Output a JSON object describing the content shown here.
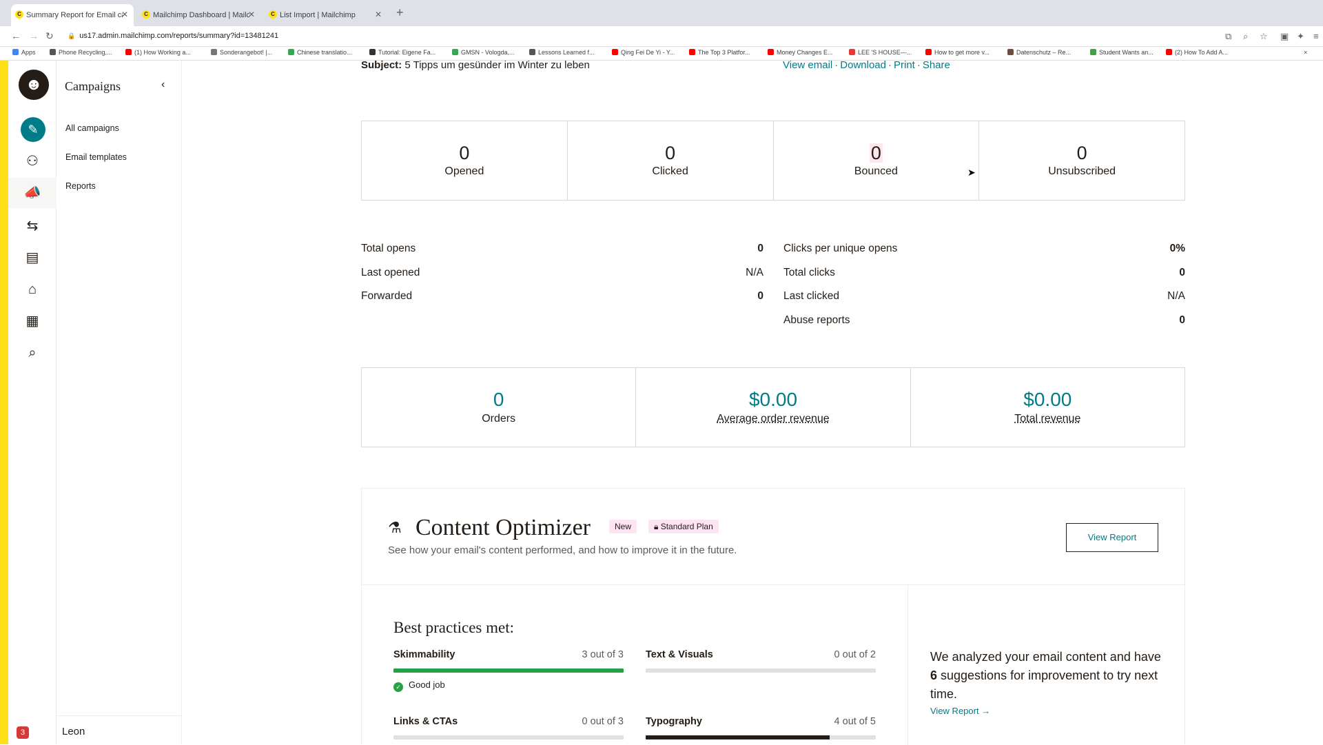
{
  "browser": {
    "tabs": [
      {
        "title": "Summary Report for Email cam",
        "active": true
      },
      {
        "title": "Mailchimp Dashboard | Mailch",
        "active": false
      },
      {
        "title": "List Import | Mailchimp",
        "active": false
      }
    ],
    "url": "us17.admin.mailchimp.com/reports/summary?id=13481241",
    "bookmarks": [
      {
        "label": "Apps",
        "color": "#4285f4"
      },
      {
        "label": "Phone Recycling,...",
        "color": "#555555"
      },
      {
        "label": "(1) How Working a...",
        "color": "#ff0000"
      },
      {
        "label": "Sonderangebot! |...",
        "color": "#777777"
      },
      {
        "label": "Chinese translatio...",
        "color": "#34a853"
      },
      {
        "label": "Tutorial: Eigene Fa...",
        "color": "#333333"
      },
      {
        "label": "GMSN - Vologda,...",
        "color": "#34a853"
      },
      {
        "label": "Lessons Learned f...",
        "color": "#555555"
      },
      {
        "label": "Qing Fei De Yi - Y...",
        "color": "#ff0000"
      },
      {
        "label": "The Top 3 Platfor...",
        "color": "#ff0000"
      },
      {
        "label": "Money Changes E...",
        "color": "#ff0000"
      },
      {
        "label": "LEE 'S HOUSE—...",
        "color": "#e53935"
      },
      {
        "label": "How to get more v...",
        "color": "#ff0000"
      },
      {
        "label": "Datenschutz – Re...",
        "color": "#6d4c41"
      },
      {
        "label": "Student Wants an...",
        "color": "#43a047"
      },
      {
        "label": "(2) How To Add A...",
        "color": "#ff0000"
      }
    ]
  },
  "sidebar": {
    "section_title": "Campaigns",
    "items": [
      "All campaigns",
      "Email templates",
      "Reports"
    ],
    "user_name": "Leon",
    "notification_count": "3"
  },
  "report": {
    "subject_label": "Subject:",
    "subject": "5 Tipps um gesünder im Winter zu leben",
    "links": [
      "View email",
      "Download",
      "Print",
      "Share"
    ],
    "stats": [
      {
        "value": "0",
        "label": "Opened"
      },
      {
        "value": "0",
        "label": "Clicked"
      },
      {
        "value": "0",
        "label": "Bounced"
      },
      {
        "value": "0",
        "label": "Unsubscribed"
      }
    ],
    "left_details": [
      {
        "label": "Total opens",
        "value": "0"
      },
      {
        "label": "Last opened",
        "value": "N/A"
      },
      {
        "label": "Forwarded",
        "value": "0"
      }
    ],
    "right_details": [
      {
        "label": "Clicks per unique opens",
        "value": "0%"
      },
      {
        "label": "Total clicks",
        "value": "0"
      },
      {
        "label": "Last clicked",
        "value": "N/A"
      },
      {
        "label": "Abuse reports",
        "value": "0"
      }
    ],
    "revenue": [
      {
        "value": "0",
        "label": "Orders"
      },
      {
        "value": "$0.00",
        "label": "Average order revenue"
      },
      {
        "value": "$0.00",
        "label": "Total revenue"
      }
    ]
  },
  "optimizer": {
    "title": "Content Optimizer",
    "new_badge": "New",
    "plan_badge": "Standard Plan",
    "subtitle": "See how your email's content performed, and how to improve it in the future.",
    "view_report_button": "View Report",
    "best_practices_title": "Best practices met:",
    "metrics": [
      {
        "name": "Skimmability",
        "count": "3 out of 3",
        "fraction": 1.0,
        "color": "#25a244",
        "note": "Good job"
      },
      {
        "name": "Text & Visuals",
        "count": "0 out of 2",
        "fraction": 0.0,
        "color": "#e0e0e0"
      },
      {
        "name": "Links & CTAs",
        "count": "0 out of 3",
        "fraction": 0.0,
        "color": "#e0e0e0"
      },
      {
        "name": "Typography",
        "count": "4 out of 5",
        "fraction": 0.8,
        "color": "#241c15"
      }
    ],
    "analysis_pre": "We analyzed your email content and have ",
    "analysis_count": "6",
    "analysis_post": " suggestions for improvement to try next time.",
    "analysis_link": "View Report"
  }
}
